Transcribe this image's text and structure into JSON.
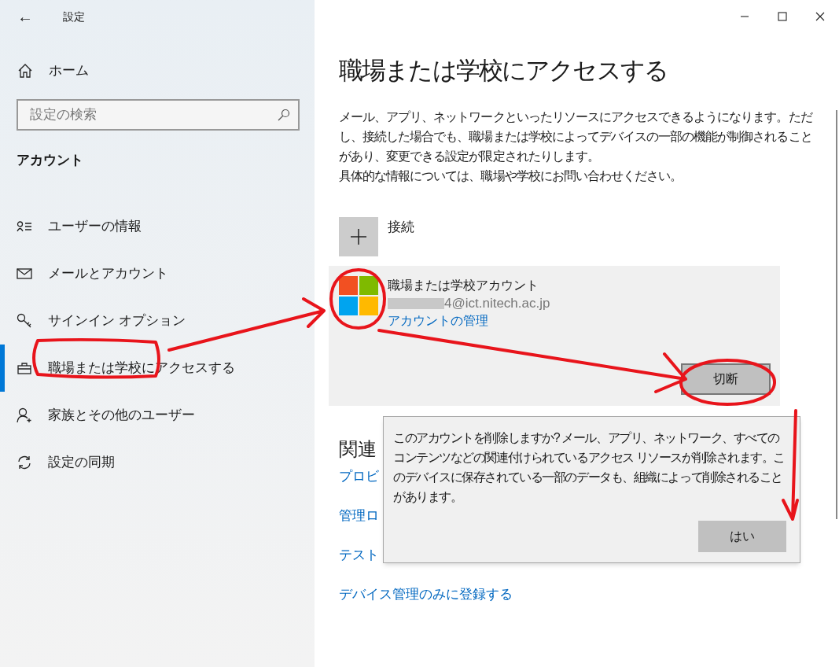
{
  "window": {
    "title": "設定",
    "back": "←"
  },
  "sidebar": {
    "home": "ホーム",
    "search": {
      "placeholder": "設定の検索"
    },
    "section": "アカウント",
    "items": [
      {
        "label": "ユーザーの情報",
        "kind": "person-list",
        "selected": false
      },
      {
        "label": "メールとアカウント",
        "kind": "mail",
        "selected": false
      },
      {
        "label": "サインイン オプション",
        "kind": "key",
        "selected": false
      },
      {
        "label": "職場または学校にアクセスする",
        "kind": "briefcase",
        "selected": true
      },
      {
        "label": "家族とその他のユーザー",
        "kind": "person-add",
        "selected": false
      },
      {
        "label": "設定の同期",
        "kind": "sync",
        "selected": false
      }
    ]
  },
  "main": {
    "title": "職場または学校にアクセスする",
    "description": [
      "メール、アプリ、ネットワークといったリソースにアクセスできるようになります。ただし、接続した場合でも、職場または学校によってデバイスの一部の機能が制御されることがあり、変更できる設定が限定されたりします。",
      "具体的な情報については、職場や学校にお問い合わせください。"
    ],
    "connect": {
      "label": "接続"
    },
    "account": {
      "name": "職場または学校アカウント",
      "email": "4@ict.nitech.ac.jp",
      "manage_link": "アカウントの管理",
      "disconnect_button": "切断"
    },
    "related": {
      "heading": "関連",
      "links": [
        "プロビ",
        "管理ロ",
        "テスト",
        "デバイス管理のみに登録する"
      ]
    }
  },
  "dialog": {
    "message": "このアカウントを削除しますか? メール、アプリ、ネットワーク、すべてのコンテンツなどの関連付けられているアクセス リソースが削除されます。このデバイスに保存されている一部のデータも、組織によって削除されることがあります。",
    "button": "はい"
  }
}
